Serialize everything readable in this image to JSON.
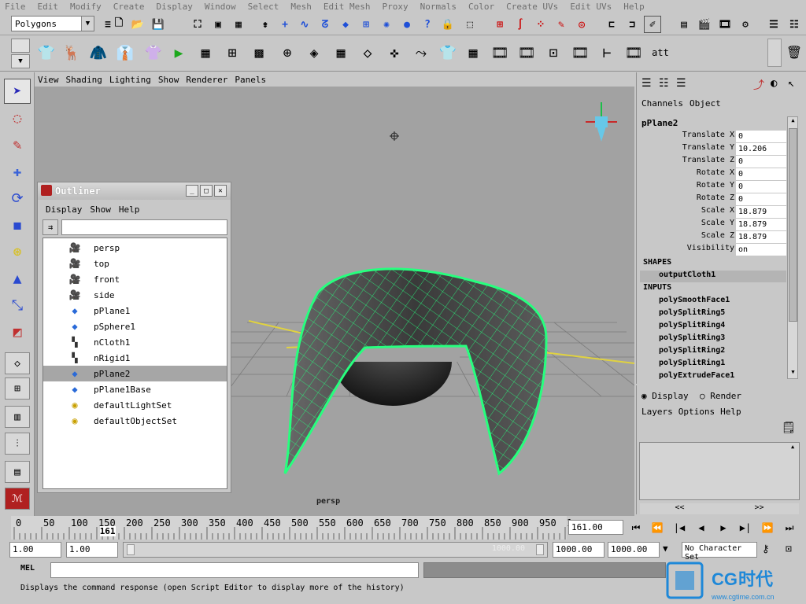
{
  "menubar": [
    "File",
    "Edit",
    "Modify",
    "Create",
    "Display",
    "Window",
    "Select",
    "Mesh",
    "Edit Mesh",
    "Proxy",
    "Normals",
    "Color",
    "Create UVs",
    "Edit UVs",
    "Help"
  ],
  "mode_menu": {
    "value": "Polygons"
  },
  "panel_menu": [
    "View",
    "Shading",
    "Lighting",
    "Show",
    "Renderer",
    "Panels"
  ],
  "viewport": {
    "camera_label": "persp"
  },
  "outliner": {
    "title": "Outliner",
    "menu": [
      "Display",
      "Show",
      "Help"
    ],
    "items": [
      {
        "name": "persp",
        "icon": "camera-icon",
        "selected": false
      },
      {
        "name": "top",
        "icon": "camera-icon",
        "selected": false
      },
      {
        "name": "front",
        "icon": "camera-icon",
        "selected": false
      },
      {
        "name": "side",
        "icon": "camera-icon",
        "selected": false
      },
      {
        "name": "pPlane1",
        "icon": "mesh-icon",
        "selected": false
      },
      {
        "name": "pSphere1",
        "icon": "mesh-icon",
        "selected": false
      },
      {
        "name": "nCloth1",
        "icon": "ncloth-icon",
        "selected": false
      },
      {
        "name": "nRigid1",
        "icon": "nrigid-icon",
        "selected": false
      },
      {
        "name": "pPlane2",
        "icon": "mesh-icon",
        "selected": true
      },
      {
        "name": "pPlane1Base",
        "icon": "mesh-icon",
        "selected": false
      },
      {
        "name": "defaultLightSet",
        "icon": "set-icon",
        "selected": false
      },
      {
        "name": "defaultObjectSet",
        "icon": "set-icon",
        "selected": false
      }
    ]
  },
  "channel_box": {
    "menu": [
      "Channels",
      "Object"
    ],
    "object_name": "pPlane2",
    "attributes": [
      {
        "label": "Translate X",
        "value": "0"
      },
      {
        "label": "Translate Y",
        "value": "10.206"
      },
      {
        "label": "Translate Z",
        "value": "0"
      },
      {
        "label": "Rotate X",
        "value": "0"
      },
      {
        "label": "Rotate Y",
        "value": "0"
      },
      {
        "label": "Rotate Z",
        "value": "0"
      },
      {
        "label": "Scale X",
        "value": "18.879"
      },
      {
        "label": "Scale Y",
        "value": "18.879"
      },
      {
        "label": "Scale Z",
        "value": "18.879"
      },
      {
        "label": "Visibility",
        "value": "on"
      }
    ],
    "shapes_header": "SHAPES",
    "shapes": [
      "outputCloth1"
    ],
    "inputs_header": "INPUTS",
    "inputs": [
      "polySmoothFace1",
      "polySplitRing5",
      "polySplitRing4",
      "polySplitRing3",
      "polySplitRing2",
      "polySplitRing1",
      "polyExtrudeFace1"
    ]
  },
  "layer_editor": {
    "radio_display": "Display",
    "radio_render": "Render",
    "menu": [
      "Layers",
      "Options",
      "Help"
    ],
    "scroll_left": "<<",
    "scroll_right": ">>"
  },
  "timeline": {
    "ticks": [
      "0",
      "50",
      "100",
      "150",
      "200",
      "250",
      "300",
      "350",
      "400",
      "450",
      "500",
      "550",
      "600",
      "650",
      "700",
      "750",
      "800",
      "850",
      "900",
      "950",
      "1"
    ],
    "current_frame_marker": "161",
    "current_frame_field": "161.00",
    "start": 0,
    "end": 1000,
    "current": 161
  },
  "range": {
    "start_time": "1.00",
    "playback_start": "1.00",
    "slider_end_label": "1000.00",
    "playback_end": "1000.00",
    "end_time": "1000.00",
    "character_set": "No Character Set"
  },
  "help_line": "Displays the command response (open Script Editor to display more of the history)",
  "command_line": {
    "mode": "MEL"
  },
  "colors": {
    "mesh_wire": "#27ff7e",
    "viewport_bg": "#a2a2a2",
    "selection": "#a6a6a6"
  }
}
